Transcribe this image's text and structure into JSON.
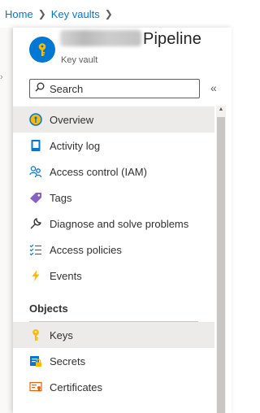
{
  "breadcrumb": {
    "items": [
      "Home",
      "Key vaults"
    ]
  },
  "blade": {
    "title_visible": "Pipeline",
    "subtitle": "Key vault",
    "icon": "key-vault-icon"
  },
  "search": {
    "placeholder": "Search",
    "value": ""
  },
  "menu": {
    "items": [
      {
        "label": "Overview",
        "icon": "overview-icon",
        "selected": true
      },
      {
        "label": "Activity log",
        "icon": "activity-log-icon",
        "selected": false
      },
      {
        "label": "Access control (IAM)",
        "icon": "access-control-icon",
        "selected": false
      },
      {
        "label": "Tags",
        "icon": "tag-icon",
        "selected": false
      },
      {
        "label": "Diagnose and solve problems",
        "icon": "wrench-icon",
        "selected": false
      },
      {
        "label": "Access policies",
        "icon": "access-policies-icon",
        "selected": false
      },
      {
        "label": "Events",
        "icon": "lightning-icon",
        "selected": false
      }
    ],
    "section": {
      "title": "Objects",
      "items": [
        {
          "label": "Keys",
          "icon": "key-icon",
          "selected": true
        },
        {
          "label": "Secrets",
          "icon": "secret-icon",
          "selected": false
        },
        {
          "label": "Certificates",
          "icon": "certificate-icon",
          "selected": false
        }
      ]
    }
  },
  "colors": {
    "link": "#0078d4",
    "selected_bg": "#edebe9",
    "key_yellow": "#ffb900"
  }
}
